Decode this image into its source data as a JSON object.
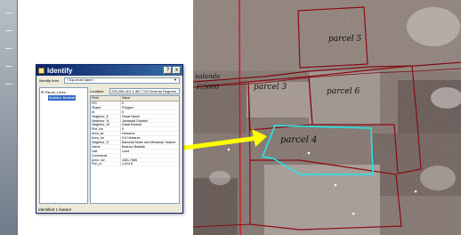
{
  "identify": {
    "title": "Identify",
    "help_label": "?",
    "close_label": "x",
    "identify_from_label": "Identify from",
    "identify_from_value": "<Top-most layer>",
    "tree": {
      "layer": "Parcel_Lines",
      "feature": "Ballabur Batalab"
    },
    "location_label": "Location:",
    "location_value": "235,256.413  4,367,723 Decimal Degrees",
    "columns": [
      "Field",
      "Value"
    ],
    "rows": [
      [
        "FID",
        "5"
      ],
      [
        "Shape",
        "Polygon"
      ],
      [
        "Id",
        "0"
      ],
      [
        "Neighbor_E",
        "Desai Nandi"
      ],
      [
        "Neighbor_N",
        "Jangwadi Dhatrigi"
      ],
      [
        "Neighbor_W",
        "Dasai Barewe"
      ],
      [
        "Plot_No",
        "5"
      ],
      [
        "Area_ak",
        "Hectares"
      ],
      [
        "Area_ha",
        "0.6 Hectares"
      ],
      [
        "Neighbor_S",
        "Baboolal Maan and Mewawar Yadave"
      ],
      [
        "Name",
        "Badraur Batalab"
      ],
      [
        "Use",
        "Land"
      ],
      [
        "Comments",
        ""
      ],
      [
        "Area_m2",
        "1551.7885"
      ],
      [
        "Peri_m",
        "1,614.8"
      ]
    ],
    "status": "Identified 1 feature"
  },
  "map": {
    "labels": {
      "parcel_5": "parcel 5",
      "parcel_3": "parcel 3",
      "parcel_6": "parcel 6",
      "parcel_4": "parcel 4",
      "neighbor_1": "nalanda",
      "neighbor_2": "F/3000"
    },
    "colors": {
      "parcel_outline": "#8b0a12",
      "selected_outline": "#27e6e6",
      "gridline": "#d3131f",
      "arrow": "#ffff00"
    }
  }
}
